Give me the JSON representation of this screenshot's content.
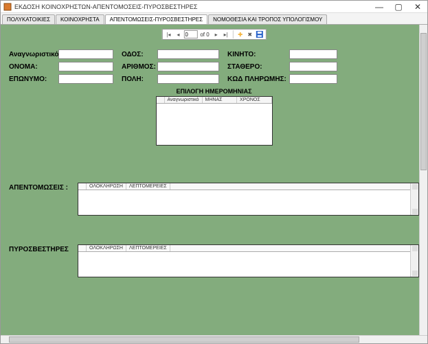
{
  "window": {
    "title": "ΕΚΔΟΣΗ ΚΟΙΝΟΧΡΗΣΤΩΝ-ΑΠΕΝΤΟΜΟΣΕΙΣ-ΠΥΡΟΣΒΕΣΤΗΡΕΣ"
  },
  "tabs": {
    "t0": "ΠΟΛΥΚΑΤΟΙΚΙΕΣ",
    "t1": "ΚΟΙΝΟΧΡΗΣΤΑ",
    "t2": "ΑΠΕΝΤΟΜΩΣΕΙΣ-ΠΥΡΟΣΒΕΣΤΗΡΕΣ",
    "t3": "ΝΟΜΟΘΕΣΙΑ ΚΑΙ ΤΡΟΠΟΣ ΥΠΟΛΟΓΙΣΜΟΥ"
  },
  "nav": {
    "current": "0",
    "of_label": "of 0"
  },
  "fields": {
    "id_label": "Αναγνωριστικό:",
    "name_label": "ΟΝΟΜΑ:",
    "surname_label": "ΕΠΩΝΥΜΟ:",
    "street_label": "ΟΔΟΣ:",
    "number_label": "ΑΡΙΘΜΟΣ:",
    "city_label": "ΠΟΛΗ:",
    "mobile_label": "ΚΙΝΗΤΟ:",
    "phone_label": "ΣΤΑΘΕΡΟ:",
    "paycode_label": "ΚΩΔ ΠΛΗΡΩΜΗΣ:",
    "id_value": "",
    "name_value": "",
    "surname_value": "",
    "street_value": "",
    "number_value": "",
    "city_value": "",
    "mobile_value": "",
    "phone_value": "",
    "paycode_value": ""
  },
  "date_panel": {
    "title": "ΕΠΙΛΟΓΗ ΗΜΕΡΟΜΗΝΙΑΣ",
    "col_id": "Αναγνωριστικό",
    "col_month": "ΜΗΝΑΣ",
    "col_year": "ΧΡΟΝΟΣ"
  },
  "sections": {
    "pest_label": "ΑΠΕΝΤΟΜΩΣΕΙΣ :",
    "fire_label": "ΠΥΡΟΣΒΕΣΤΗΡΕΣ",
    "col_completion": "ΟΛΟΚΛΗΡΩΣΗ",
    "col_details": "ΛΕΠΤΟΜΕΡΕΙΕΣ"
  }
}
